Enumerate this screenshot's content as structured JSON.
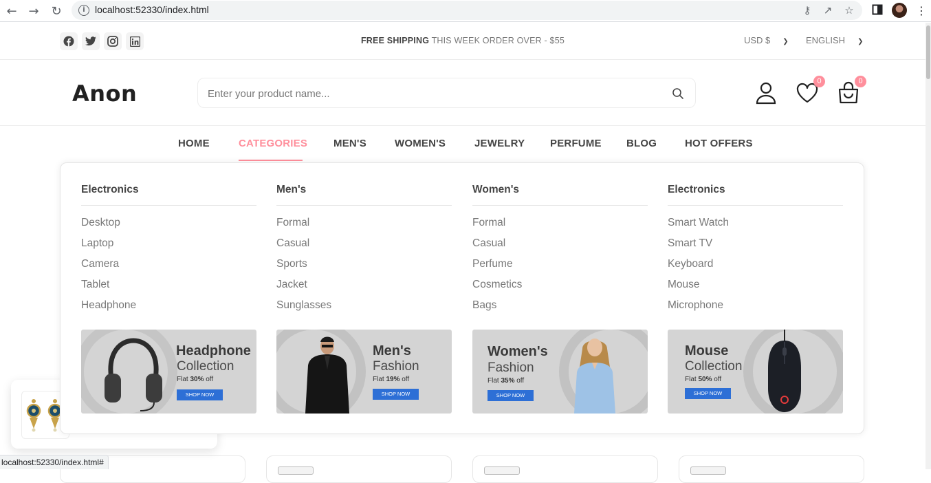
{
  "browser": {
    "url": "localhost:52330/index.html",
    "status_url": "localhost:52330/index.html#"
  },
  "topbar": {
    "shipping_bold": "FREE SHIPPING",
    "shipping_rest": " THIS WEEK ORDER OVER - $55",
    "currency": "USD $",
    "language": "ENGLISH",
    "social": [
      "facebook-icon",
      "twitter-icon",
      "instagram-icon",
      "linkedin-icon"
    ]
  },
  "header": {
    "logo": "Anon",
    "search_placeholder": "Enter your product name...",
    "wishlist_count": "0",
    "cart_count": "0"
  },
  "menu": {
    "items": [
      "HOME",
      "CATEGORIES",
      "MEN'S",
      "WOMEN'S",
      "JEWELRY",
      "PERFUME",
      "BLOG",
      "HOT OFFERS"
    ],
    "active": "CATEGORIES",
    "accent": "#ff8f9c"
  },
  "dropdown": {
    "columns": [
      {
        "title": "Electronics",
        "items": [
          "Desktop",
          "Laptop",
          "Camera",
          "Tablet",
          "Headphone"
        ]
      },
      {
        "title": "Men's",
        "items": [
          "Formal",
          "Casual",
          "Sports",
          "Jacket",
          "Sunglasses"
        ]
      },
      {
        "title": "Women's",
        "items": [
          "Formal",
          "Casual",
          "Perfume",
          "Cosmetics",
          "Bags"
        ]
      },
      {
        "title": "Electronics",
        "items": [
          "Smart Watch",
          "Smart TV",
          "Keyboard",
          "Mouse",
          "Microphone"
        ]
      }
    ],
    "banners": [
      {
        "title1": "Headphone",
        "title2": "Collection",
        "flat_prefix": "Flat ",
        "discount": "30%",
        "flat_suffix": " off",
        "cta": "SHOP NOW"
      },
      {
        "title1": "Men's",
        "title2": "Fashion",
        "flat_prefix": "Flat ",
        "discount": "19%",
        "flat_suffix": " off",
        "cta": "SHOP NOW"
      },
      {
        "title1": "Women's",
        "title2": "Fashion",
        "flat_prefix": "Flat ",
        "discount": "35%",
        "flat_suffix": " off",
        "cta": "SHOP NOW"
      },
      {
        "title1": "Mouse",
        "title2": "Collection",
        "flat_prefix": "Flat ",
        "discount": "50%",
        "flat_suffix": " off",
        "cta": "SHOP NOW"
      }
    ]
  }
}
